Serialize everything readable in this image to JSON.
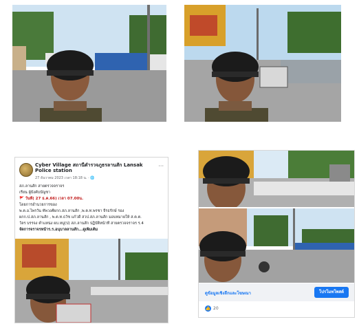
{
  "post": {
    "page_name": "Cyber Village สถานีตำรวจภูธรลานสัก Lansak Police station",
    "date": "27 ธันวาคม 2023 เวลา 18:18 น. · 🌐",
    "more_icon": "more-horizontal-icon",
    "lines": [
      "สภ.ลานสัก  สายตรวจจราจร",
      "เรียน ผู้บังคับบัญชา",
      "🚩 วันที่( 27 ธ.ค.66) เวลา 07.00น.",
      "โดยการอำนวยการของ",
      "   พ.ต.อ.ไพรวัน ทัพวงศ์ผกก.สภ.ลานสัก ,พ.ต.ท.พรชา จีรธรักษ์ รอง",
      "ผกก.ป.สภ.ลานสัก , พ.ต.ท.ธวัช แก้วดี สวป.สภ.ลานสัก มอบหมายให้ ส.ต.ต.",
      "วัลร บรรจง ตำแหน่ง ผบ.หมู่(ป) สภ.ลานสัก ปฏิบัติหน้าที่ สายตรวจจราจร ร.4",
      "จัดการจราจรหน้าร.ร.อนุบาลลานสัก...ดูเพิ่มเติม"
    ]
  },
  "ad": {
    "link_text": "ดูข้อมูลเชิงลึกและโฆษณา",
    "button_label": "โปรโมทโพสต์",
    "reaction_count": "20",
    "reaction_icon": "like-icon"
  },
  "colors": {
    "facebook_blue": "#1877f2",
    "card_border": "#d6d6d6",
    "footer_bg": "#f0f2f5"
  }
}
